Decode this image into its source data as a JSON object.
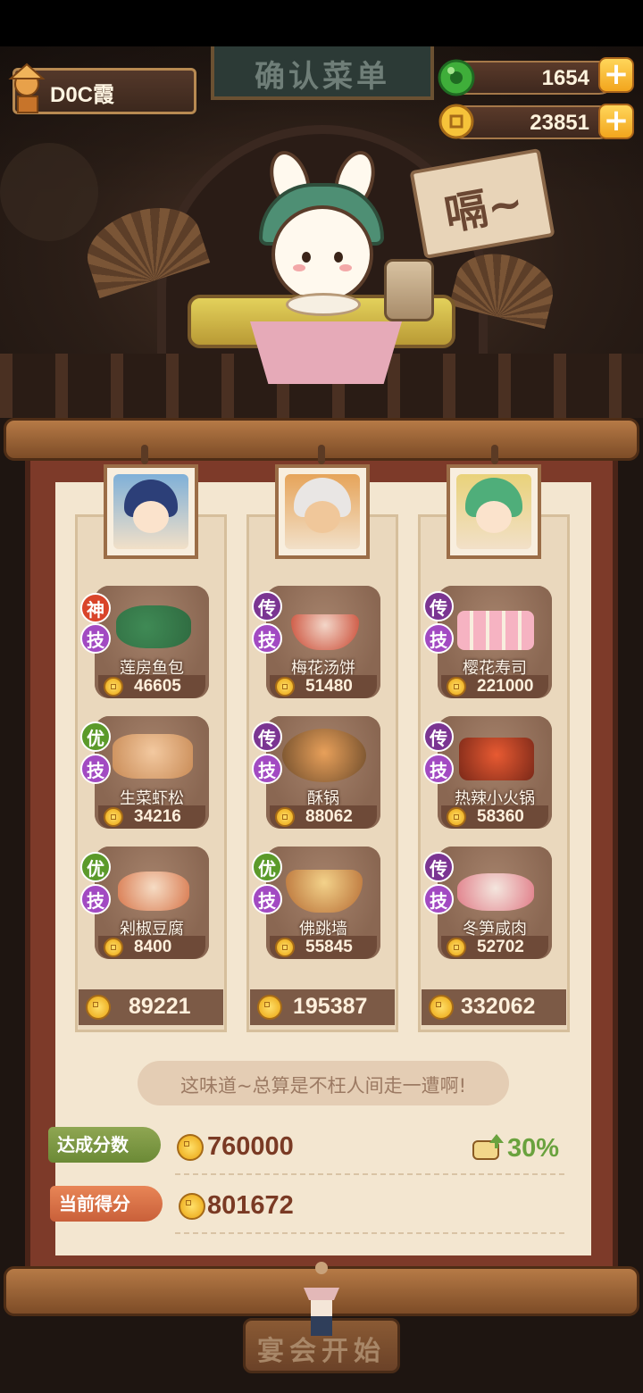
{
  "player": {
    "name": "D0C霞"
  },
  "sign": {
    "text": "确认菜单"
  },
  "resources": [
    {
      "icon": "jade-icon",
      "value": "1654"
    },
    {
      "icon": "coin-icon",
      "value": "23851"
    }
  ],
  "scene": {
    "speech": "嗝~"
  },
  "columns": [
    {
      "portrait": "chef-blue-hair-portrait",
      "total": "89221",
      "dishes": [
        {
          "tier": "神",
          "skill": "技",
          "name": "莲房鱼包",
          "price": "46605"
        },
        {
          "tier": "优",
          "skill": "技",
          "name": "生菜虾松",
          "price": "34216"
        },
        {
          "tier": "优",
          "skill": "技",
          "name": "剁椒豆腐",
          "price": "8400"
        }
      ]
    },
    {
      "portrait": "chef-white-hair-portrait",
      "total": "195387",
      "dishes": [
        {
          "tier": "传",
          "skill": "技",
          "name": "梅花汤饼",
          "price": "51480"
        },
        {
          "tier": "传",
          "skill": "技",
          "name": "酥锅",
          "price": "88062"
        },
        {
          "tier": "优",
          "skill": "技",
          "name": "佛跳墙",
          "price": "55845"
        }
      ]
    },
    {
      "portrait": "chef-green-hair-portrait",
      "total": "332062",
      "dishes": [
        {
          "tier": "传",
          "skill": "技",
          "name": "樱花寿司",
          "price": "221000"
        },
        {
          "tier": "传",
          "skill": "技",
          "name": "热辣小火锅",
          "price": "58360"
        },
        {
          "tier": "传",
          "skill": "技",
          "name": "冬笋咸肉",
          "price": "52702"
        }
      ]
    }
  ],
  "quote": "这味道~总算是不枉人间走一遭啊!",
  "score": {
    "target_label": "达成分数",
    "target_value": "760000",
    "current_label": "当前得分",
    "current_value": "801672",
    "bonus": "30%"
  },
  "start_button": "宴会开始",
  "colors": {
    "board": "#7d3a29",
    "paper": "#f3e6d0",
    "score_text": "#7a3a24",
    "bonus_green": "#6aa23e"
  }
}
